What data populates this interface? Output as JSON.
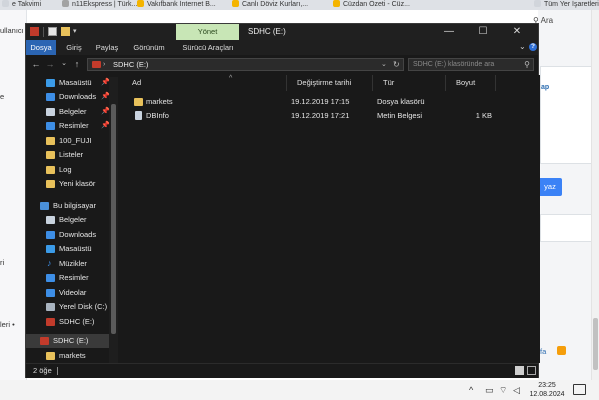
{
  "browser": {
    "bookmarks": [
      {
        "label": "e Takvimi",
        "color": "#d1d5db"
      },
      {
        "label": "n11Ekspress | Türk...",
        "color": "#a3a3a3"
      },
      {
        "label": "Vakıfbank İnternet B...",
        "color": "#f4b400"
      },
      {
        "label": "Canlı Döviz Kurları,...",
        "color": "#f4b400"
      },
      {
        "label": "Cüzdan Özeti - Cüz...",
        "color": "#f4b400"
      },
      {
        "label": "Tüm Yer İşaretleri",
        "color": "#d1d5db"
      }
    ],
    "left_fragments": [
      "ullanıcı",
      "e",
      "ri",
      "leri",
      "leri • "
    ],
    "search_button": "Ara",
    "map_link": "ap",
    "write_button": "yaz",
    "footer_link": "fa"
  },
  "explorer": {
    "manage_tab": "Yönet",
    "window_title": "SDHC (E:)",
    "window_controls": {
      "minimize": "—",
      "maximize": "☐",
      "close": "✕"
    },
    "ribbon_tabs": [
      "Dosya",
      "Giriş",
      "Paylaş",
      "Görünüm",
      "Sürücü Araçları"
    ],
    "address_path": "SDHC (E:)",
    "search_placeholder": "SDHC (E:) klasöründe ara",
    "columns": [
      "Ad",
      "Değiştirme tarihi",
      "Tür",
      "Boyut"
    ],
    "files": [
      {
        "name": "markets",
        "modified": "19.12.2019 17:15",
        "type": "Dosya klasörü",
        "size": "",
        "icon": "folder-icon"
      },
      {
        "name": "DBInfo",
        "modified": "19.12.2019 17:21",
        "type": "Metin Belgesi",
        "size": "1 KB",
        "icon": "text-file-icon"
      }
    ],
    "nav_items": [
      {
        "label": "Masaüstü",
        "icon": "desktop-icon",
        "pinned": true
      },
      {
        "label": "Downloads",
        "icon": "download-icon",
        "pinned": true
      },
      {
        "label": "Belgeler",
        "icon": "documents-icon",
        "pinned": true
      },
      {
        "label": "Resimler",
        "icon": "pictures-icon",
        "pinned": true
      },
      {
        "label": "100_FUJI",
        "icon": "folder-icon",
        "pinned": false
      },
      {
        "label": "Listeler",
        "icon": "folder-icon",
        "pinned": false
      },
      {
        "label": "Log",
        "icon": "folder-icon",
        "pinned": false
      },
      {
        "label": "Yeni klasör",
        "icon": "folder-icon",
        "pinned": false
      },
      {
        "label": "Bu bilgisayar",
        "icon": "this-pc-icon",
        "pinned": false
      },
      {
        "label": "Belgeler",
        "icon": "documents-icon",
        "pinned": false
      },
      {
        "label": "Downloads",
        "icon": "download-icon",
        "pinned": false
      },
      {
        "label": "Masaüstü",
        "icon": "desktop-icon",
        "pinned": false
      },
      {
        "label": "Müzikler",
        "icon": "music-icon",
        "pinned": false
      },
      {
        "label": "Resimler",
        "icon": "pictures-icon",
        "pinned": false
      },
      {
        "label": "Videolar",
        "icon": "videos-icon",
        "pinned": false
      },
      {
        "label": "Yerel Disk (C:)",
        "icon": "drive-icon",
        "pinned": false
      },
      {
        "label": "SDHC (E:)",
        "icon": "sd-card-icon",
        "pinned": false
      },
      {
        "label": "SDHC (E:)",
        "icon": "sd-card-icon",
        "pinned": false,
        "selected": true
      },
      {
        "label": "markets",
        "icon": "folder-icon",
        "pinned": false
      }
    ],
    "status_text": "2 öğe"
  },
  "taskbar": {
    "time": "23:25",
    "date": "12.08.2024"
  }
}
